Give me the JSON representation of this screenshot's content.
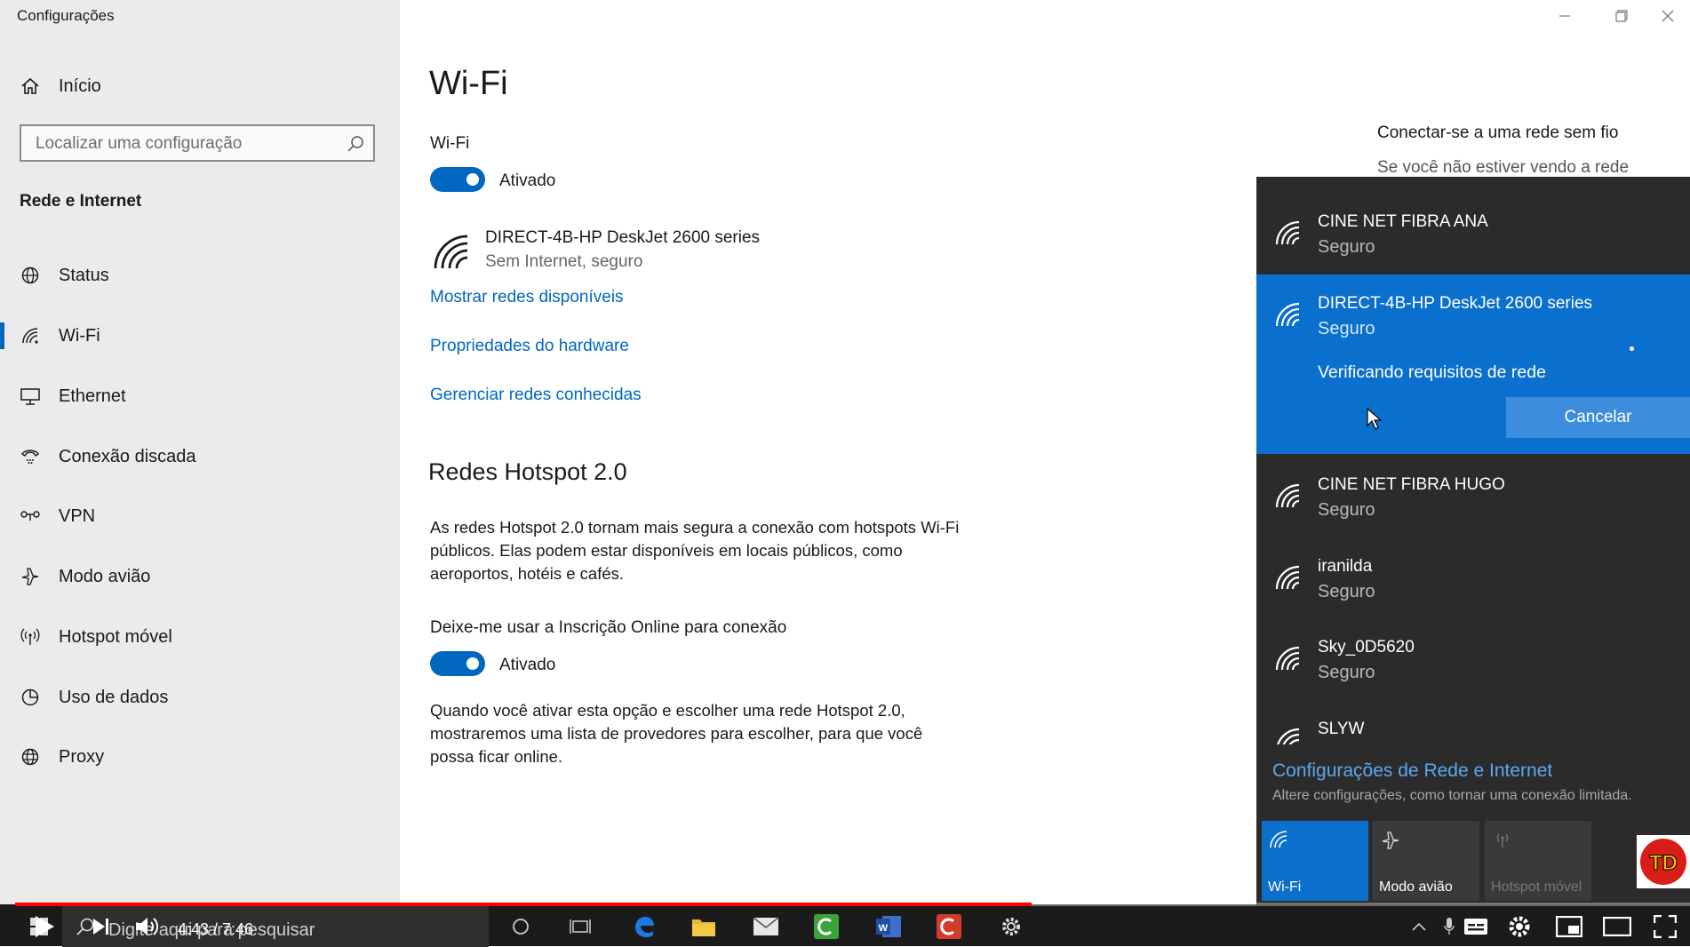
{
  "window": {
    "title": "Configurações"
  },
  "sidebar": {
    "home_label": "Início",
    "search_placeholder": "Localizar uma configuração",
    "section_heading": "Rede e Internet",
    "items": [
      {
        "label": "Status",
        "icon": "globe-status-icon"
      },
      {
        "label": "Wi-Fi",
        "icon": "wifi-icon",
        "selected": true
      },
      {
        "label": "Ethernet",
        "icon": "ethernet-icon"
      },
      {
        "label": "Conexão discada",
        "icon": "dialup-icon"
      },
      {
        "label": "VPN",
        "icon": "vpn-icon"
      },
      {
        "label": "Modo avião",
        "icon": "airplane-icon"
      },
      {
        "label": "Hotspot móvel",
        "icon": "hotspot-icon"
      },
      {
        "label": "Uso de dados",
        "icon": "data-usage-icon"
      },
      {
        "label": "Proxy",
        "icon": "globe-icon"
      }
    ]
  },
  "main": {
    "title": "Wi-Fi",
    "wifi_label": "Wi-Fi",
    "wifi_toggle_state": "Ativado",
    "connected_network": {
      "name": "DIRECT-4B-HP DeskJet 2600 series",
      "status": "Sem Internet, seguro"
    },
    "links": {
      "show_networks": "Mostrar redes disponíveis",
      "hardware_properties": "Propriedades do hardware",
      "manage_known": "Gerenciar redes conhecidas"
    },
    "hotspot": {
      "heading": "Redes Hotspot 2.0",
      "description_lines": [
        "As redes Hotspot 2.0 tornam mais segura a conexão com hotspots Wi-Fi",
        "públicos. Elas podem estar disponíveis em locais públicos, como",
        "aeroportos, hotéis e cafés."
      ],
      "online_signup_label": "Deixe-me usar a Inscrição Online para conexão",
      "online_signup_state": "Ativado",
      "note_lines": [
        "Quando você ativar esta opção e escolher uma rede Hotspot 2.0,",
        "mostraremos uma lista de provedores para escolher, para que você",
        "possa ficar online."
      ]
    },
    "right_panel": {
      "heading": "Conectar-se a uma rede sem fio",
      "subtext": "Se você não estiver vendo a rede"
    }
  },
  "flyout": {
    "networks": [
      {
        "name": "CINE NET FIBRA ANA",
        "status": "Seguro"
      },
      {
        "name": "DIRECT-4B-HP DeskJet 2600 series",
        "status": "Seguro",
        "selected": true
      },
      {
        "name": "CINE NET FIBRA HUGO",
        "status": "Seguro"
      },
      {
        "name": "iranilda",
        "status": "Seguro"
      },
      {
        "name": "Sky_0D5620",
        "status": "Seguro"
      },
      {
        "name": "SLYW",
        "status": ""
      }
    ],
    "verifying_text": "Verificando requisitos de rede",
    "cancel_label": "Cancelar",
    "settings_link": "Configurações de Rede e Internet",
    "settings_desc": "Altere configurações, como tornar uma conexão limitada.",
    "tiles": [
      {
        "label": "Wi-Fi",
        "active": true
      },
      {
        "label": "Modo avião",
        "active": false
      },
      {
        "label": "Hotspot móvel",
        "active": false
      }
    ],
    "accent_color": "#0b6fce"
  },
  "player": {
    "time": "4:43 / 7:46",
    "progress_fraction": 0.607,
    "taskbar_search_placeholder": "Digite aqui para pesquisar",
    "channel_logo": "TD"
  }
}
